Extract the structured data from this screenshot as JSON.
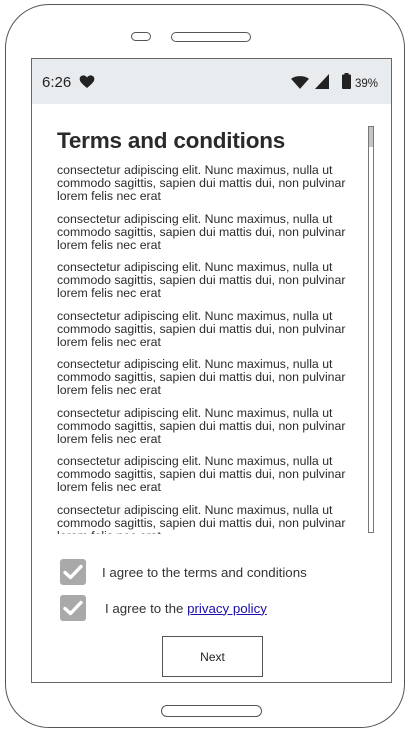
{
  "status_bar": {
    "time": "6:26",
    "battery_percent": "39%",
    "icons": [
      "heart-icon",
      "wifi-icon",
      "signal-icon",
      "battery-icon"
    ]
  },
  "page": {
    "title": "Terms and conditions",
    "paragraphs": [
      "consectetur adipiscing elit. Nunc maximus, nulla ut commodo sagittis, sapien dui mattis dui, non pulvinar lorem felis nec erat",
      "consectetur adipiscing elit. Nunc maximus, nulla ut commodo sagittis, sapien dui mattis dui, non pulvinar lorem felis nec erat",
      "consectetur adipiscing elit. Nunc maximus, nulla ut commodo sagittis, sapien dui mattis dui, non pulvinar lorem felis nec erat",
      "consectetur adipiscing elit. Nunc maximus, nulla ut commodo sagittis, sapien dui mattis dui, non pulvinar lorem felis nec erat",
      "consectetur adipiscing elit. Nunc maximus, nulla ut commodo sagittis, sapien dui mattis dui, non pulvinar lorem felis nec erat",
      "consectetur adipiscing elit. Nunc maximus, nulla ut commodo sagittis, sapien dui mattis dui, non pulvinar lorem felis nec erat",
      "consectetur adipiscing elit. Nunc maximus, nulla ut commodo sagittis, sapien dui mattis dui, non pulvinar lorem felis nec erat",
      "consectetur adipiscing elit. Nunc maximus, nulla ut commodo sagittis, sapien dui mattis dui, non pulvinar lorem felis nec erat"
    ]
  },
  "agreements": {
    "terms_label": "I agree to the terms and conditions",
    "terms_checked": true,
    "privacy_prefix": "I agree to the",
    "privacy_link": "privacy policy",
    "privacy_checked": true
  },
  "buttons": {
    "next_label": "Next"
  },
  "colors": {
    "status_bar_bg": "#e9ecee",
    "checkbox_fill": "#a9a9a9",
    "link": "#1a0dab"
  }
}
